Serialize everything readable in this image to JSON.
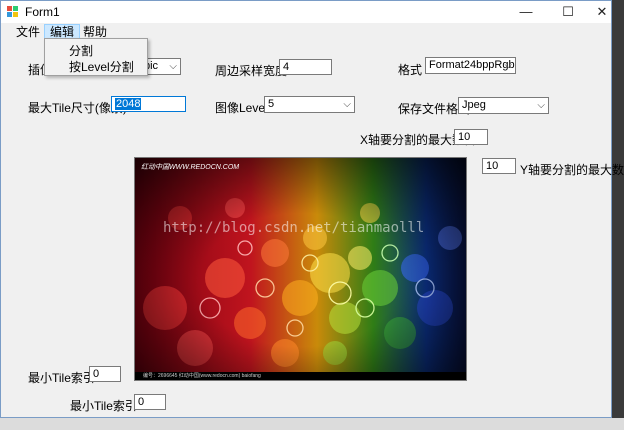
{
  "window": {
    "title": "Form1",
    "minimize": "—",
    "maximize": "☐",
    "close": "✕"
  },
  "menubar": {
    "file": "文件",
    "edit": "编辑",
    "help": "帮助"
  },
  "edit_menu": {
    "items": [
      "分割",
      "按Level分割"
    ]
  },
  "form": {
    "interp_label": "插值",
    "interp_value": "bic",
    "edge_label": "周边采样宽度",
    "edge_value": "4",
    "format_label": "格式",
    "format_value": "Format24bppRgb",
    "max_tile_label": "最大Tile尺寸(像素)",
    "max_tile_value": "2048",
    "level_label": "图像Level",
    "level_value": "5",
    "save_format_label": "保存文件格式",
    "save_format_value": "Jpeg",
    "x_split_label": "X轴要分割的最大数目",
    "x_split_value": "10",
    "y_split_label": "Y轴要分割的最大数目",
    "y_split_value": "10",
    "min_tile_y_label": "最小Tile索引Y",
    "min_tile_y_value": "0",
    "min_tile_x_label": "最小Tile索引X",
    "min_tile_x_value": "0"
  },
  "image": {
    "header_text": "红动中国WWW.REDOCN.COM",
    "watermark": "http://blog.csdn.net/tianmaolll",
    "footer_text": "编号：2696645    红动中国(www.redocn.com)    baiofang"
  }
}
